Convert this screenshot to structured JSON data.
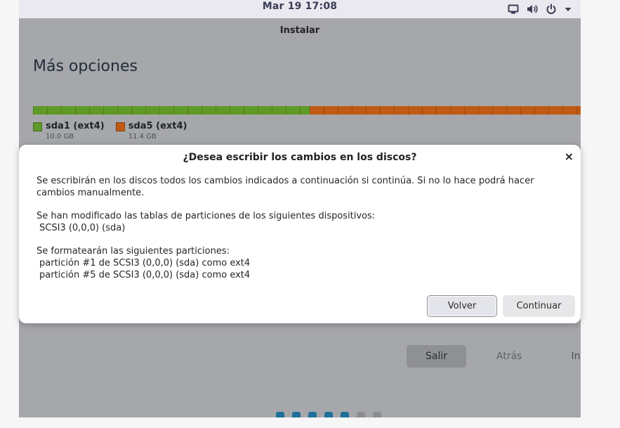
{
  "top_panel": {
    "datetime": "Mar 19  17:08",
    "icons": [
      "screen-icon",
      "volume-icon",
      "power-icon",
      "chevron-down-icon"
    ]
  },
  "installer": {
    "window_title": "Instalar",
    "page_heading": "Más opciones",
    "partitions": [
      {
        "name": "sda1 (ext4)",
        "size": "10.0 GB",
        "color": "#5f9a28"
      },
      {
        "name": "sda5 (ext4)",
        "size": "11.4 GB",
        "color": "#c05a14"
      }
    ],
    "buttons": {
      "quit": "Salir",
      "back": "Atrás",
      "install": "Instalar"
    },
    "progress": {
      "total_steps": 7,
      "completed_steps": 5,
      "active_color": "#1e6f99"
    }
  },
  "dialog": {
    "title": "¿Desea escribir los cambios en los discos?",
    "close_glyph": "×",
    "intro": "Se escribirán en los discos todos los cambios indicados a continuación si continúa. Si no lo hace podrá hacer cambios manualmente.",
    "tables_heading": "Se han modificado las tablas de particiones de los siguientes dispositivos:",
    "devices": [
      "SCSI3 (0,0,0) (sda)"
    ],
    "format_heading": "Se formatearán las siguientes particiones:",
    "format_list": [
      "partición #1 de SCSI3 (0,0,0) (sda) como ext4",
      "partición #5 de SCSI3 (0,0,0) (sda) como ext4"
    ],
    "buttons": {
      "back": "Volver",
      "continue": "Continuar"
    }
  }
}
